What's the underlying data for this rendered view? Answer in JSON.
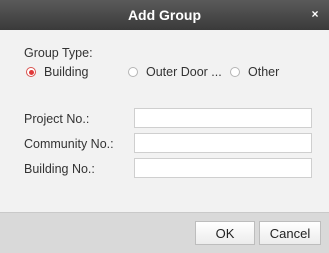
{
  "dialog": {
    "title": "Add Group",
    "close_label": "×"
  },
  "group_type": {
    "label": "Group Type:",
    "options": [
      {
        "label": "Building",
        "selected": true
      },
      {
        "label": "Outer Door ...",
        "selected": false
      },
      {
        "label": "Other",
        "selected": false
      }
    ]
  },
  "fields": {
    "project_label": "Project No.:",
    "project_value": "",
    "community_label": "Community No.:",
    "community_value": "",
    "building_label": "Building No.:",
    "building_value": ""
  },
  "footer": {
    "ok_label": "OK",
    "cancel_label": "Cancel"
  },
  "colors": {
    "titlebar": "#4a4a4a",
    "radio_selected": "#e0393a",
    "body_bg": "#f2f2f2",
    "footer_bg": "#d9d9d9"
  }
}
